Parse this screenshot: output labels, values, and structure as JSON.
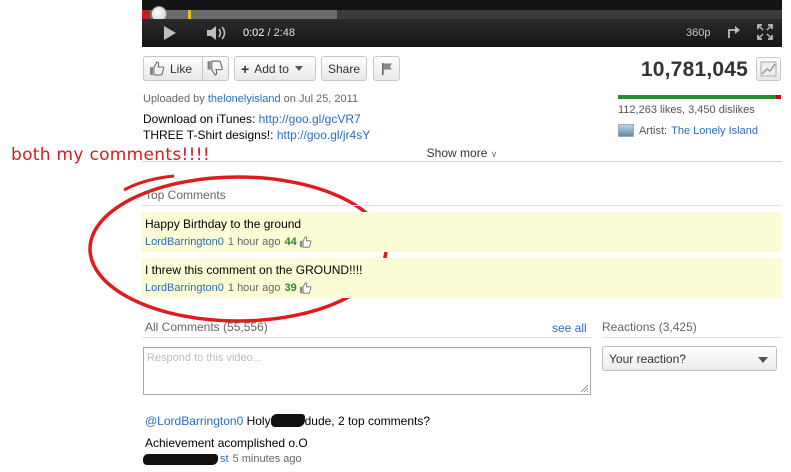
{
  "player": {
    "time_current": "0:02",
    "time_separator": " / ",
    "time_total": "2:48",
    "quality": "360p",
    "played_fraction": 0.012,
    "buffered_fraction": 0.305,
    "icons": [
      "play-icon",
      "volume-icon",
      "popout-icon",
      "fullscreen-icon"
    ]
  },
  "actions": {
    "like_label": "Like",
    "add_to_label": "Add to",
    "share_label": "Share"
  },
  "stats": {
    "view_count": "10,781,045",
    "likes_dislikes": "112,263 likes, 3,450 dislikes",
    "like_ratio": 0.97,
    "artist_label": "Artist:",
    "artist_name": "The Lonely Island"
  },
  "uploader": {
    "prefix": "Uploaded by ",
    "name": "thelonelyisland",
    "suffix": " on Jul 25, 2011"
  },
  "description": {
    "line1_text": "Download on iTunes: ",
    "line1_link": "http://goo.gl/gcVR7",
    "line2_text": "THREE T-Shirt designs!: ",
    "line2_link": "http://goo.gl/jr4sY",
    "show_more": "Show more"
  },
  "annotation": {
    "text": "both my comments!!!!",
    "color": "#d12020"
  },
  "top_comments": {
    "title": "Top Comments",
    "items": [
      {
        "text": "Happy Birthday to the ground",
        "user": "LordBarrington0",
        "time": "1 hour ago",
        "votes": "44"
      },
      {
        "text": "I threw this comment on the GROUND!!!!",
        "user": "LordBarrington0",
        "time": "1 hour ago",
        "votes": "39"
      }
    ]
  },
  "all_comments": {
    "title": "All Comments",
    "count": "(55,556)",
    "see_all": "see all",
    "placeholder": "Respond to this video..."
  },
  "reactions": {
    "title": "Reactions",
    "count": "(3,425)",
    "select_value": "Your reaction?"
  },
  "reply": {
    "mention": "@LordBarrington0",
    "text_a": " Holy",
    "text_b": "dude, 2 top comments?",
    "line2": "Achievement acomplished o.O",
    "user_tail": "st",
    "time": "5 minutes ago"
  },
  "colors": {
    "accent_link": "#2a6ebb",
    "progress_red": "#cc181e",
    "highlight_bg": "#fbfbd6",
    "vote_green": "#2e8b2e"
  }
}
